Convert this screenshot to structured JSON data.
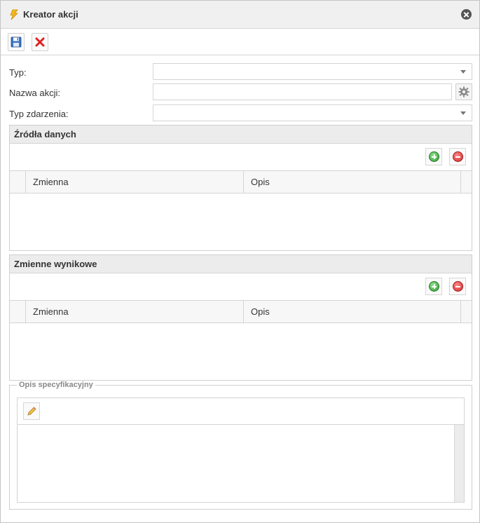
{
  "window": {
    "title": "Kreator akcji",
    "app_icon": "lightning-icon",
    "close_icon": "close-icon"
  },
  "toolbar": {
    "save_icon": "floppy-disk-icon",
    "cancel_icon": "red-x-icon"
  },
  "form": {
    "type_label": "Typ:",
    "type_value": "",
    "name_label": "Nazwa akcji:",
    "name_value": "",
    "event_type_label": "Typ zdarzenia:",
    "event_type_value": ""
  },
  "data_sources": {
    "title": "Źródła danych",
    "columns": [
      "Zmienna",
      "Opis"
    ],
    "rows": []
  },
  "output_variables": {
    "title": "Zmienne wynikowe",
    "columns": [
      "Zmienna",
      "Opis"
    ],
    "rows": []
  },
  "specification": {
    "legend": "Opis specyfikacyjny",
    "edit_icon": "pencil-icon",
    "content": ""
  },
  "colors": {
    "header_bg": "#f0f0f0",
    "panel_header_bg": "#ececec",
    "border": "#d4d4d4",
    "add_green": "#2e9a2e",
    "remove_red": "#d02a2a"
  }
}
